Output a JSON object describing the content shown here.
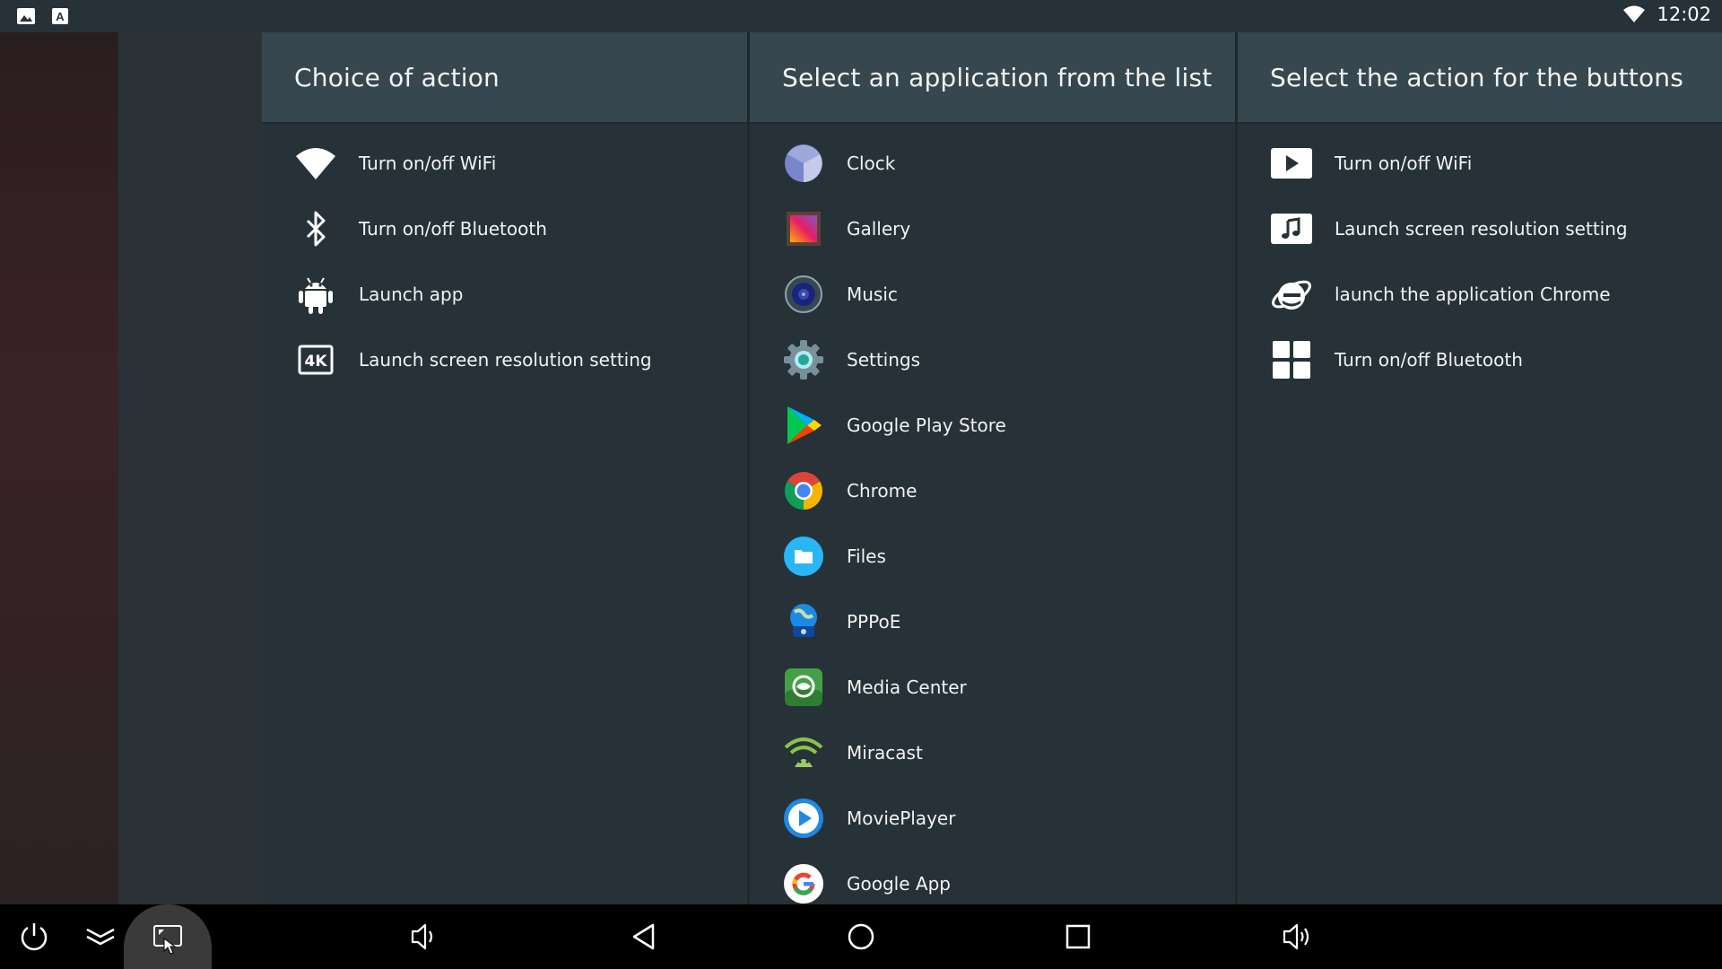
{
  "status_bar": {
    "time": "12:02",
    "left_icons": [
      "image-icon",
      "text-a-icon"
    ],
    "right_icons": [
      "wifi-icon"
    ]
  },
  "columns": [
    {
      "title": "Choice of action",
      "items": [
        {
          "label": "Turn on/off WiFi",
          "icon": "wifi-icon"
        },
        {
          "label": "Turn on/off Bluetooth",
          "icon": "bluetooth-icon"
        },
        {
          "label": "Launch app",
          "icon": "android-icon"
        },
        {
          "label": "Launch screen resolution setting",
          "icon": "4k-icon"
        }
      ]
    },
    {
      "title": "Select an application from the list",
      "items": [
        {
          "label": "Clock",
          "icon": "clock-icon"
        },
        {
          "label": "Gallery",
          "icon": "gallery-icon"
        },
        {
          "label": "Music",
          "icon": "music-icon"
        },
        {
          "label": "Settings",
          "icon": "settings-gear-icon"
        },
        {
          "label": "Google Play Store",
          "icon": "play-store-icon"
        },
        {
          "label": "Chrome",
          "icon": "chrome-icon"
        },
        {
          "label": "Files",
          "icon": "files-icon"
        },
        {
          "label": "PPPoE",
          "icon": "pppoe-icon"
        },
        {
          "label": "Media Center",
          "icon": "media-center-icon"
        },
        {
          "label": "Miracast",
          "icon": "miracast-icon"
        },
        {
          "label": "MoviePlayer",
          "icon": "movie-player-icon"
        },
        {
          "label": "Google App",
          "icon": "google-icon"
        }
      ]
    },
    {
      "title": "Select the action for the buttons",
      "items": [
        {
          "label": "Turn on/off WiFi",
          "icon": "play-button-icon"
        },
        {
          "label": "Launch screen resolution setting",
          "icon": "music-note-icon"
        },
        {
          "label": "launch the application Chrome",
          "icon": "internet-explorer-icon"
        },
        {
          "label": "Turn on/off Bluetooth",
          "icon": "windows-icon"
        }
      ]
    }
  ],
  "nav_bar": {
    "buttons": [
      "power-icon",
      "collapse-icon",
      "screenshot-icon",
      "volume-down-icon",
      "back-icon",
      "home-icon",
      "recents-icon",
      "volume-up-icon"
    ]
  },
  "colors": {
    "header_bg": "#37474f",
    "panel_bg": "#263238",
    "navbar_bg": "#000000"
  }
}
